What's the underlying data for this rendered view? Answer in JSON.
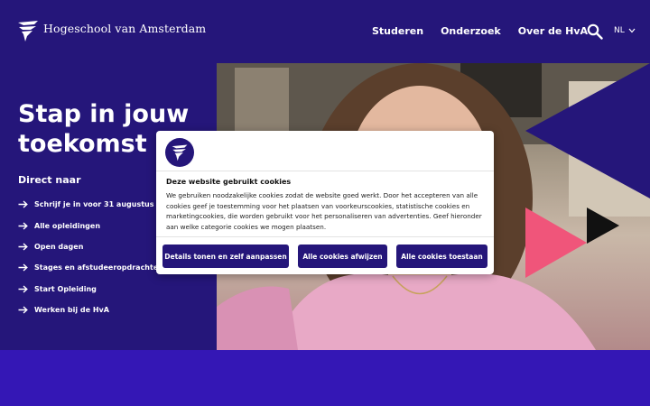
{
  "header": {
    "logo_text": "Hogeschool van Amsterdam",
    "nav": [
      "Studeren",
      "Onderzoek",
      "Over de HvA"
    ],
    "language": "NL"
  },
  "hero": {
    "title": "Stap in jouw toekomst",
    "direct_title": "Direct naar",
    "links": [
      "Schrijf je in voor 31 augustus",
      "Alle opleidingen",
      "Open dagen",
      "Stages en afstudeeropdrachten",
      "Start Opleiding",
      "Werken bij de HvA"
    ]
  },
  "cookie": {
    "title": "Deze website gebruikt cookies",
    "body": "We gebruiken noodzakelijke cookies zodat de website goed werkt. Door het accepteren van alle cookies geef je toestemming voor het plaatsen van voorkeurscookies, statistische cookies en marketingcookies, die worden gebruikt voor het personaliseren van advertenties. Geef hieronder aan welke categorie cookies we mogen plaatsen.",
    "btn_details": "Details tonen en zelf aanpassen",
    "btn_reject": "Alle cookies afwijzen",
    "btn_accept": "Alle cookies toestaan"
  },
  "colors": {
    "brand_dark": "#25167a",
    "brand_violet": "#3417b5",
    "accent_pink": "#f0557a"
  }
}
